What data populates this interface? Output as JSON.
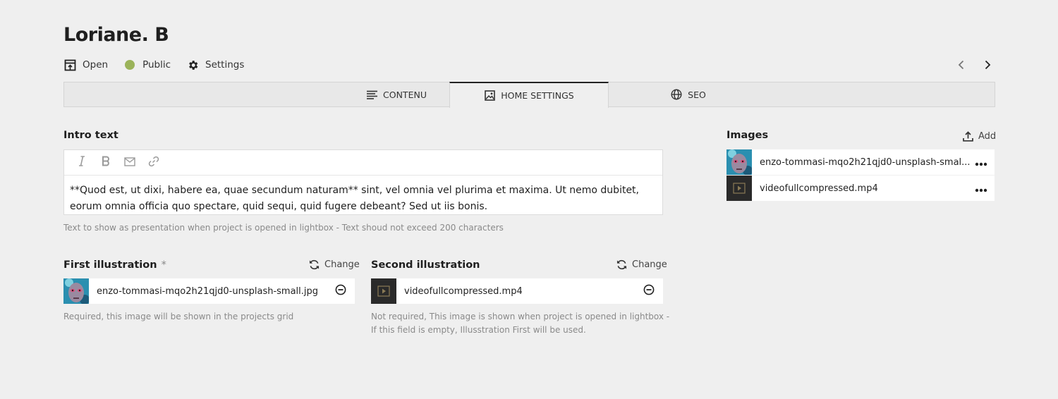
{
  "page": {
    "title": "Loriane. B"
  },
  "header": {
    "open_label": "Open",
    "status_label": "Public",
    "settings_label": "Settings",
    "status_color": "#9bb35a",
    "icons": {
      "open": "open-external-icon",
      "status": "status-dot",
      "settings": "gear-icon",
      "prev": "chevron-left-icon",
      "next": "chevron-right-icon"
    }
  },
  "tabs": [
    {
      "label": "CONTENU",
      "icon": "text-lines-icon",
      "active": false
    },
    {
      "label": "HOME SETTINGS",
      "icon": "image-icon",
      "active": true
    },
    {
      "label": "SEO",
      "icon": "globe-icon",
      "active": false
    }
  ],
  "intro": {
    "label": "Intro text",
    "toolbar": [
      "italic-icon",
      "bold-icon",
      "email-icon",
      "link-icon"
    ],
    "content": "**Quod est, ut dixi, habere ea, quae secundum naturam** sint, vel omnia vel plurima et maxima. Ut nemo dubitet, eorum omnia officia quo spectare, quid sequi, quid fugere debeant? Sed ut iis bonis.",
    "help": "Text to show as presentation when project is opened in lightbox - Text shoud not exceed 200 characters"
  },
  "first_illustration": {
    "label": "First illustration",
    "required_mark": "*",
    "change_label": "Change",
    "file": "enzo-tommasi-mqo2h21qjd0-unsplash-small.jpg",
    "help": "Required, this image will be shown in the projects grid"
  },
  "second_illustration": {
    "label": "Second illustration",
    "change_label": "Change",
    "file": "videofullcompressed.mp4",
    "help_line1": "Not required, This image is shown when project is opened in lightbox -",
    "help_line2": "If this field is empty, Illusstration First will be used."
  },
  "images": {
    "label": "Images",
    "add_label": "Add",
    "files": [
      {
        "name": "enzo-tommasi-mqo2h21qjd0-unsplash-smal...",
        "kind": "image"
      },
      {
        "name": "videofullcompressed.mp4",
        "kind": "video"
      }
    ]
  },
  "colors": {
    "background": "#efefef",
    "accent_status": "#9bb35a",
    "text": "#1f1f1f",
    "help_text": "#8a8a8a"
  }
}
